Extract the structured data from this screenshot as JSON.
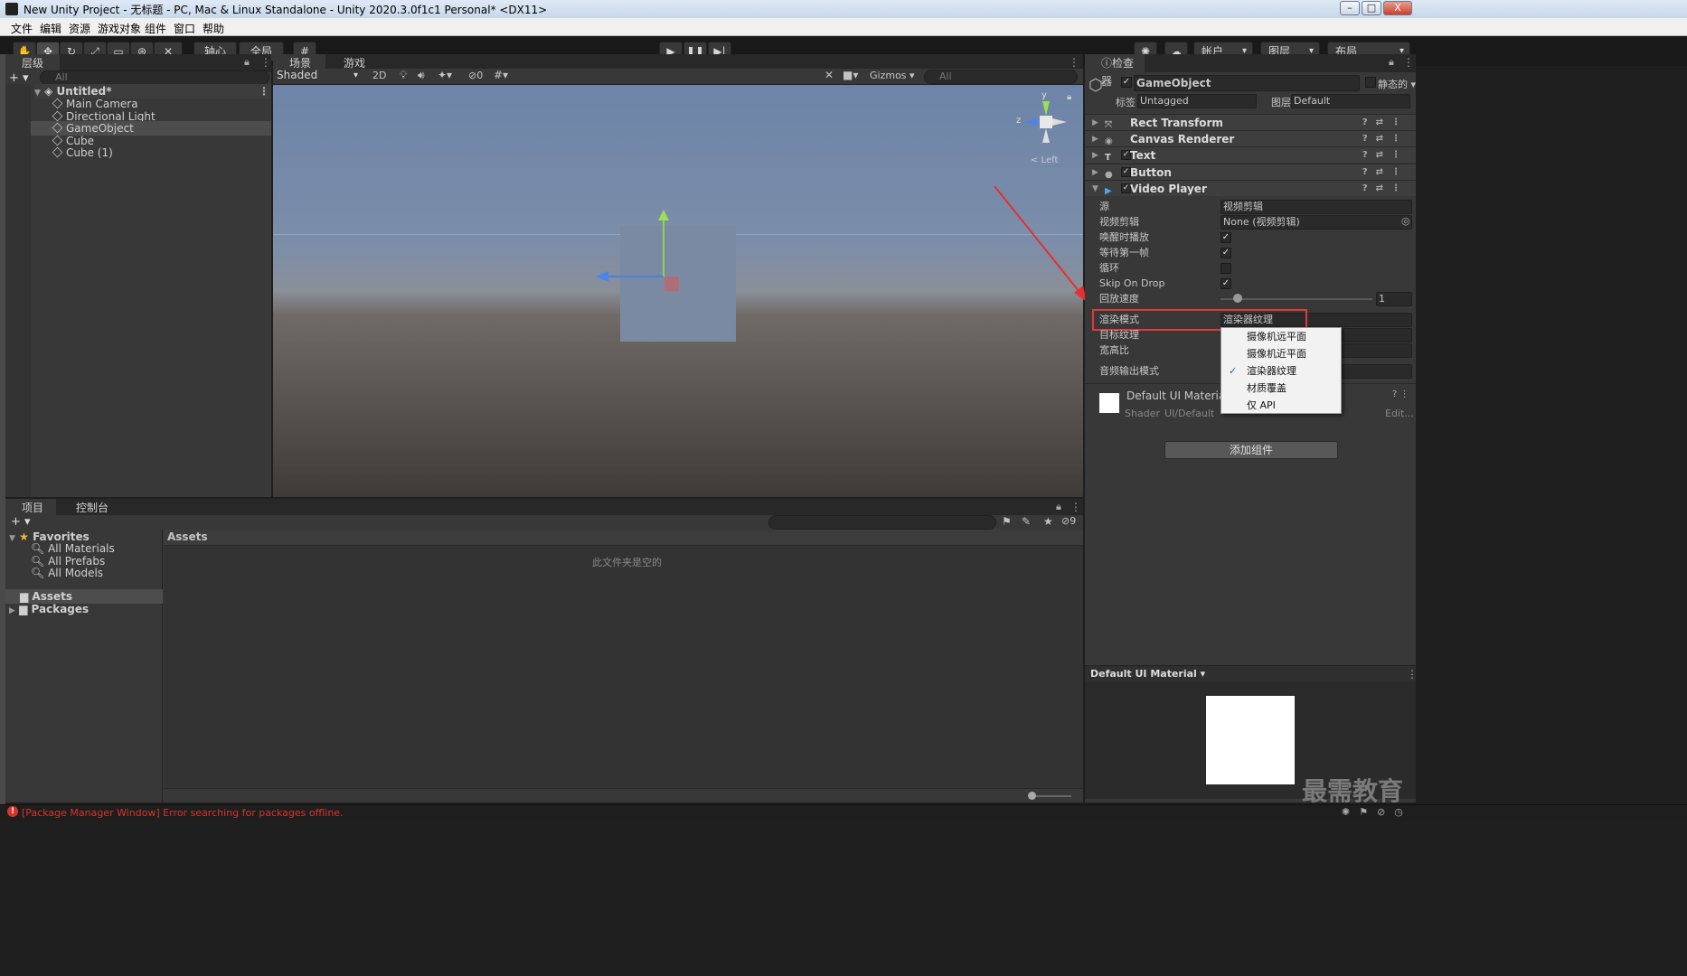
{
  "window": {
    "title": "New Unity Project - 无标题 - PC, Mac & Linux Standalone - Unity 2020.3.0f1c1 Personal* <DX11>",
    "min": "–",
    "max": "□",
    "close": "X"
  },
  "menu": [
    "文件",
    "编辑",
    "资源",
    "游戏对象",
    "组件",
    "窗口",
    "帮助"
  ],
  "toolbar": {
    "pivot": "轴心",
    "global": "全局",
    "account": "帐户",
    "layers": "图层",
    "layout": "布局"
  },
  "hierarchy": {
    "tab": "层级",
    "search_placeholder": "All",
    "scene": "Untitled*",
    "items": [
      "Main Camera",
      "Directional Light",
      "GameObject",
      "Cube",
      "Cube (1)"
    ],
    "selected": "GameObject"
  },
  "scene": {
    "tab_scene": "场景",
    "tab_game": "游戏",
    "shading": "Shaded",
    "mode_2d": "2D",
    "hidden_count": "0",
    "gizmos": "Gizmos",
    "search_placeholder": "All",
    "orientation": "< Left",
    "axis_y": "y",
    "axis_z": "z"
  },
  "inspector": {
    "tab": "检查器",
    "object_name": "GameObject",
    "static_label": "静态的",
    "tag_label": "标签",
    "tag_value": "Untagged",
    "layer_label": "图层",
    "layer_value": "Default",
    "components": [
      {
        "name": "Rect Transform",
        "checked": false
      },
      {
        "name": "Canvas Renderer",
        "checked": false
      },
      {
        "name": "Text",
        "checked": true
      },
      {
        "name": "Button",
        "checked": true
      },
      {
        "name": "Video Player",
        "checked": true
      }
    ],
    "video_player": {
      "source_label": "源",
      "source_value": "视频剪辑",
      "clip_label": "视频剪辑",
      "clip_value": "None (视频剪辑)",
      "play_on_awake_label": "唤醒时播放",
      "play_on_awake": true,
      "wait_first_frame_label": "等待第一帧",
      "wait_first_frame": true,
      "loop_label": "循环",
      "loop": false,
      "skip_on_drop_label": "Skip On Drop",
      "skip_on_drop": true,
      "speed_label": "回放速度",
      "speed_value": "1",
      "render_mode_label": "渲染模式",
      "render_mode_value": "渲染器纹理",
      "target_texture_label": "目标纹理",
      "aspect_label": "宽高比",
      "audio_output_label": "音频输出模式"
    },
    "render_mode_options": [
      {
        "label": "摄像机远平面",
        "selected": false
      },
      {
        "label": "摄像机近平面",
        "selected": false
      },
      {
        "label": "渲染器纹理",
        "selected": true
      },
      {
        "label": "材质覆盖",
        "selected": false
      },
      {
        "label": "仅 API",
        "selected": false
      }
    ],
    "material_name": "Default UI Material",
    "shader_label": "Shader",
    "shader_value": "UI/Default",
    "edit_label": "Edit...",
    "add_component": "添加组件",
    "preview_title": "Default UI Material"
  },
  "project": {
    "tab_project": "项目",
    "tab_console": "控制台",
    "favorites_label": "Favorites",
    "favorites": [
      "All Materials",
      "All Prefabs",
      "All Models"
    ],
    "assets_label": "Assets",
    "packages_label": "Packages",
    "breadcrumb": "Assets",
    "empty_message": "此文件夹是空的",
    "hidden_count": "9"
  },
  "status": {
    "error": "[Package Manager Window] Error searching for packages offline."
  },
  "watermark": "最需教育",
  "colors": {
    "accent_red": "#e03a3a",
    "selection": "#4d4d4d",
    "sky": "#6f85a8",
    "ground": "#5b5550"
  }
}
